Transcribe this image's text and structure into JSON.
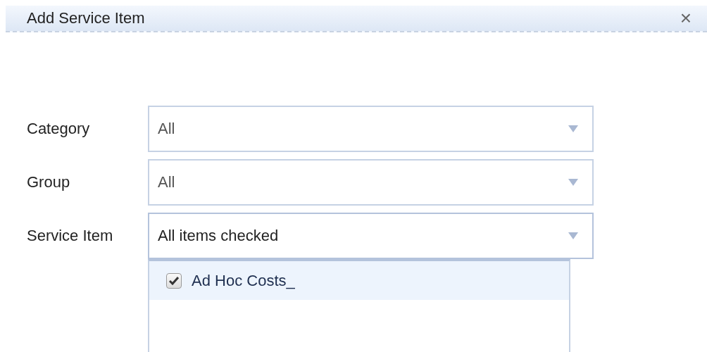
{
  "dialog": {
    "title": "Add Service Item",
    "close": "×"
  },
  "fields": [
    {
      "label": "Category",
      "value": "All",
      "open": false
    },
    {
      "label": "Group",
      "value": "All",
      "open": false
    },
    {
      "label": "Service Item",
      "value": "All items checked",
      "open": true
    }
  ],
  "dropdown": {
    "items": [
      {
        "label": "Ad Hoc Costs_",
        "checked": true,
        "selected": true
      }
    ]
  }
}
